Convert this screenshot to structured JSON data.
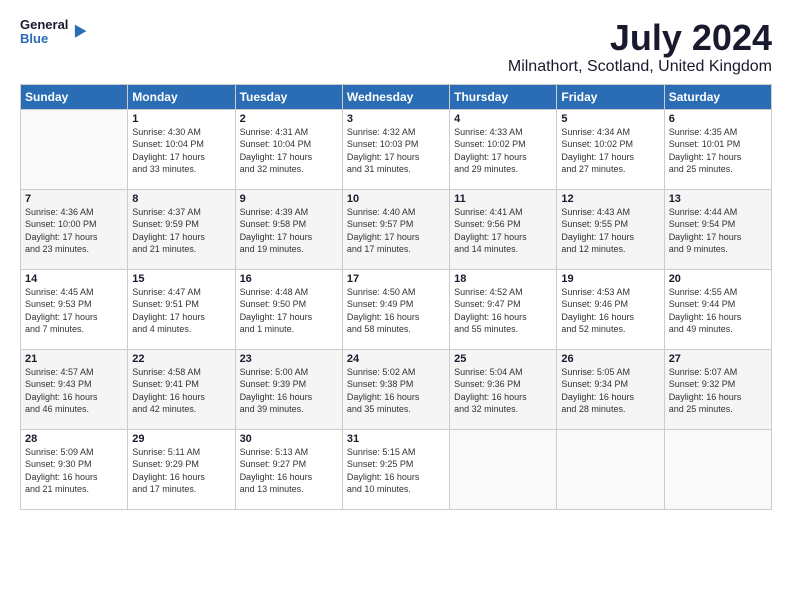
{
  "header": {
    "logo_line1": "General",
    "logo_line2": "Blue",
    "title": "July 2024",
    "subtitle": "Milnathort, Scotland, United Kingdom"
  },
  "columns": [
    "Sunday",
    "Monday",
    "Tuesday",
    "Wednesday",
    "Thursday",
    "Friday",
    "Saturday"
  ],
  "weeks": [
    [
      {
        "day": "",
        "info": ""
      },
      {
        "day": "1",
        "info": "Sunrise: 4:30 AM\nSunset: 10:04 PM\nDaylight: 17 hours\nand 33 minutes."
      },
      {
        "day": "2",
        "info": "Sunrise: 4:31 AM\nSunset: 10:04 PM\nDaylight: 17 hours\nand 32 minutes."
      },
      {
        "day": "3",
        "info": "Sunrise: 4:32 AM\nSunset: 10:03 PM\nDaylight: 17 hours\nand 31 minutes."
      },
      {
        "day": "4",
        "info": "Sunrise: 4:33 AM\nSunset: 10:02 PM\nDaylight: 17 hours\nand 29 minutes."
      },
      {
        "day": "5",
        "info": "Sunrise: 4:34 AM\nSunset: 10:02 PM\nDaylight: 17 hours\nand 27 minutes."
      },
      {
        "day": "6",
        "info": "Sunrise: 4:35 AM\nSunset: 10:01 PM\nDaylight: 17 hours\nand 25 minutes."
      }
    ],
    [
      {
        "day": "7",
        "info": "Sunrise: 4:36 AM\nSunset: 10:00 PM\nDaylight: 17 hours\nand 23 minutes."
      },
      {
        "day": "8",
        "info": "Sunrise: 4:37 AM\nSunset: 9:59 PM\nDaylight: 17 hours\nand 21 minutes."
      },
      {
        "day": "9",
        "info": "Sunrise: 4:39 AM\nSunset: 9:58 PM\nDaylight: 17 hours\nand 19 minutes."
      },
      {
        "day": "10",
        "info": "Sunrise: 4:40 AM\nSunset: 9:57 PM\nDaylight: 17 hours\nand 17 minutes."
      },
      {
        "day": "11",
        "info": "Sunrise: 4:41 AM\nSunset: 9:56 PM\nDaylight: 17 hours\nand 14 minutes."
      },
      {
        "day": "12",
        "info": "Sunrise: 4:43 AM\nSunset: 9:55 PM\nDaylight: 17 hours\nand 12 minutes."
      },
      {
        "day": "13",
        "info": "Sunrise: 4:44 AM\nSunset: 9:54 PM\nDaylight: 17 hours\nand 9 minutes."
      }
    ],
    [
      {
        "day": "14",
        "info": "Sunrise: 4:45 AM\nSunset: 9:53 PM\nDaylight: 17 hours\nand 7 minutes."
      },
      {
        "day": "15",
        "info": "Sunrise: 4:47 AM\nSunset: 9:51 PM\nDaylight: 17 hours\nand 4 minutes."
      },
      {
        "day": "16",
        "info": "Sunrise: 4:48 AM\nSunset: 9:50 PM\nDaylight: 17 hours\nand 1 minute."
      },
      {
        "day": "17",
        "info": "Sunrise: 4:50 AM\nSunset: 9:49 PM\nDaylight: 16 hours\nand 58 minutes."
      },
      {
        "day": "18",
        "info": "Sunrise: 4:52 AM\nSunset: 9:47 PM\nDaylight: 16 hours\nand 55 minutes."
      },
      {
        "day": "19",
        "info": "Sunrise: 4:53 AM\nSunset: 9:46 PM\nDaylight: 16 hours\nand 52 minutes."
      },
      {
        "day": "20",
        "info": "Sunrise: 4:55 AM\nSunset: 9:44 PM\nDaylight: 16 hours\nand 49 minutes."
      }
    ],
    [
      {
        "day": "21",
        "info": "Sunrise: 4:57 AM\nSunset: 9:43 PM\nDaylight: 16 hours\nand 46 minutes."
      },
      {
        "day": "22",
        "info": "Sunrise: 4:58 AM\nSunset: 9:41 PM\nDaylight: 16 hours\nand 42 minutes."
      },
      {
        "day": "23",
        "info": "Sunrise: 5:00 AM\nSunset: 9:39 PM\nDaylight: 16 hours\nand 39 minutes."
      },
      {
        "day": "24",
        "info": "Sunrise: 5:02 AM\nSunset: 9:38 PM\nDaylight: 16 hours\nand 35 minutes."
      },
      {
        "day": "25",
        "info": "Sunrise: 5:04 AM\nSunset: 9:36 PM\nDaylight: 16 hours\nand 32 minutes."
      },
      {
        "day": "26",
        "info": "Sunrise: 5:05 AM\nSunset: 9:34 PM\nDaylight: 16 hours\nand 28 minutes."
      },
      {
        "day": "27",
        "info": "Sunrise: 5:07 AM\nSunset: 9:32 PM\nDaylight: 16 hours\nand 25 minutes."
      }
    ],
    [
      {
        "day": "28",
        "info": "Sunrise: 5:09 AM\nSunset: 9:30 PM\nDaylight: 16 hours\nand 21 minutes."
      },
      {
        "day": "29",
        "info": "Sunrise: 5:11 AM\nSunset: 9:29 PM\nDaylight: 16 hours\nand 17 minutes."
      },
      {
        "day": "30",
        "info": "Sunrise: 5:13 AM\nSunset: 9:27 PM\nDaylight: 16 hours\nand 13 minutes."
      },
      {
        "day": "31",
        "info": "Sunrise: 5:15 AM\nSunset: 9:25 PM\nDaylight: 16 hours\nand 10 minutes."
      },
      {
        "day": "",
        "info": ""
      },
      {
        "day": "",
        "info": ""
      },
      {
        "day": "",
        "info": ""
      }
    ]
  ]
}
